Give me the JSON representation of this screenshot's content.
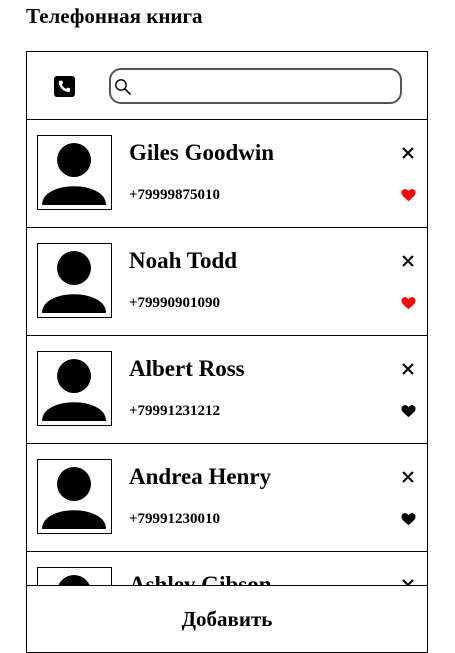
{
  "app": {
    "title": "Телефонная книга"
  },
  "search": {
    "value": "",
    "placeholder": ""
  },
  "contacts": [
    {
      "name": "Giles Goodwin",
      "phone": "+79999875010",
      "favorite": true
    },
    {
      "name": "Noah Todd",
      "phone": "+79990901090",
      "favorite": true
    },
    {
      "name": "Albert Ross",
      "phone": "+79991231212",
      "favorite": false
    },
    {
      "name": "Andrea Henry",
      "phone": "+79991230010",
      "favorite": false
    },
    {
      "name": "Ashley Gibson",
      "phone": "",
      "favorite": false
    }
  ],
  "actions": {
    "add_label": "Добавить"
  },
  "colors": {
    "favorite_on": "#ff0000",
    "favorite_off": "#000000",
    "border": "#000000",
    "search_border": "#555555"
  },
  "icons": {
    "phone": "phone-icon",
    "search": "search-icon",
    "delete": "close-icon",
    "favorite": "heart-icon",
    "avatar": "user-silhouette-icon"
  }
}
